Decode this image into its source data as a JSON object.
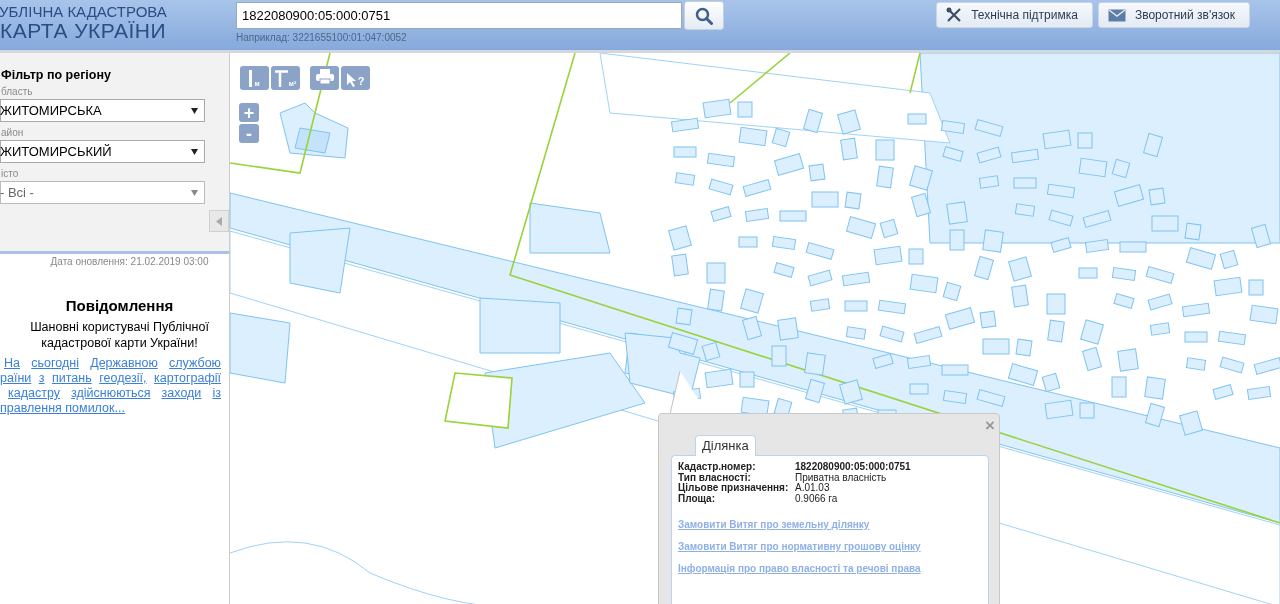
{
  "header": {
    "logo_lines": [
      "УБЛІЧНА КАДАСТРОВА",
      "КАРТА УКРАЇНИ"
    ],
    "search": {
      "value": "1822080900:05:000:0751",
      "example": "Наприклад: 3221655100:01:047:0052"
    },
    "buttons": [
      {
        "label": "Технічна підтримка"
      },
      {
        "label": "Зворотний зв'язок"
      }
    ]
  },
  "sidebar": {
    "title": "Фільтр по регіону",
    "filters": [
      {
        "label": "бласть",
        "value": "ЖИТОМИРСЬКА",
        "disabled": false
      },
      {
        "label": "айон",
        "value": "ЖИТОМИРСЬКИЙ",
        "disabled": false
      },
      {
        "label": "істо",
        "value": "- Всі -",
        "disabled": true
      }
    ],
    "updated": "Дата оновлення: 21.02.2019 03:00",
    "notice": {
      "title": "Повідомлення",
      "text": "Шановні користувачі Публічної кадастрової карти України!",
      "link_lines": [
        "На сьогодні Державною службою",
        "раїни з питань геодезії, картографії",
        "кадастру здійснюються заходи із",
        "правлення помилок..."
      ]
    }
  },
  "map": {
    "tools": [
      {
        "kind": "length",
        "sub": "м"
      },
      {
        "kind": "area",
        "sub": "м²"
      },
      {
        "kind": "print"
      },
      {
        "kind": "query",
        "sub": "?"
      }
    ],
    "zoom": [
      "+",
      "-"
    ]
  },
  "popup": {
    "tab": "Ділянка",
    "close": "×",
    "fields": [
      {
        "label": "Кадастр.номер:",
        "value": "1822080900:05:000:0751",
        "bold": true
      },
      {
        "label": "Тип власності:",
        "value": "Приватна власність",
        "bold": false
      },
      {
        "label": "Цільове призначення:",
        "value": "A.01.03",
        "bold": false
      },
      {
        "label": "Площа:",
        "value": "0.9066 га",
        "bold": false
      }
    ],
    "links": [
      "Замовити Витяг про земельну ділянку",
      "Замовити Витяг про нормативну грошову оцінку",
      "Інформація про право власності та речові права"
    ]
  }
}
